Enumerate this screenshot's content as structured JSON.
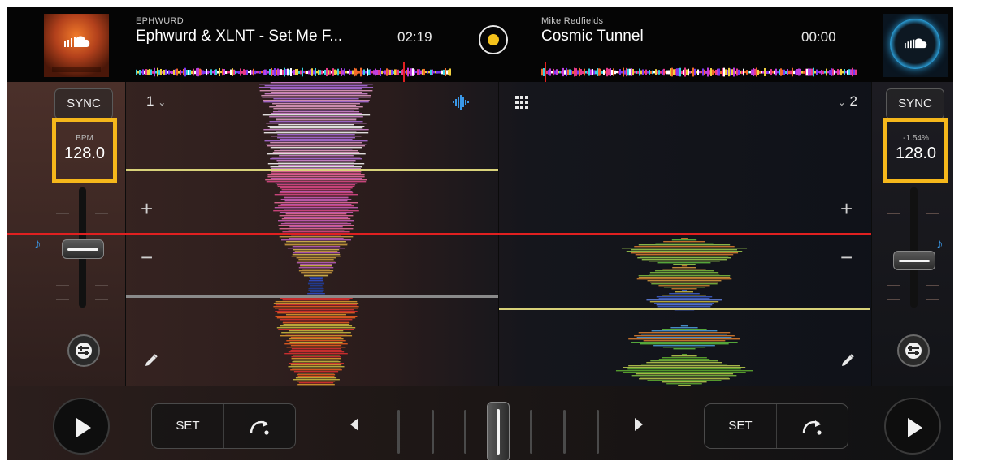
{
  "deck_left": {
    "artist": "EPHWURD",
    "track": "Ephwurd & XLNT - Set Me F...",
    "time": "02:19",
    "deck_number": "1",
    "sync_label": "SYNC",
    "bpm_label": "BPM",
    "bpm_value": "128.0",
    "cue_set_label": "SET"
  },
  "deck_right": {
    "artist": "Mike Redfields",
    "track": "Cosmic Tunnel",
    "time": "00:00",
    "deck_number": "2",
    "sync_label": "SYNC",
    "pitch_label": "-1.54%",
    "bpm_value": "128.0",
    "cue_set_label": "SET"
  },
  "colors": {
    "highlight": "#f5b71b",
    "playhead": "#e02020",
    "accent_blue": "#3a98e8",
    "logo_yellow": "#f4c21b"
  },
  "icons": [
    "soundcloud-icon",
    "waveform-icon",
    "grid-icon",
    "music-note-icon",
    "pencil-icon",
    "eq-icon",
    "play-icon",
    "loop-icon",
    "chevron-down-icon"
  ]
}
